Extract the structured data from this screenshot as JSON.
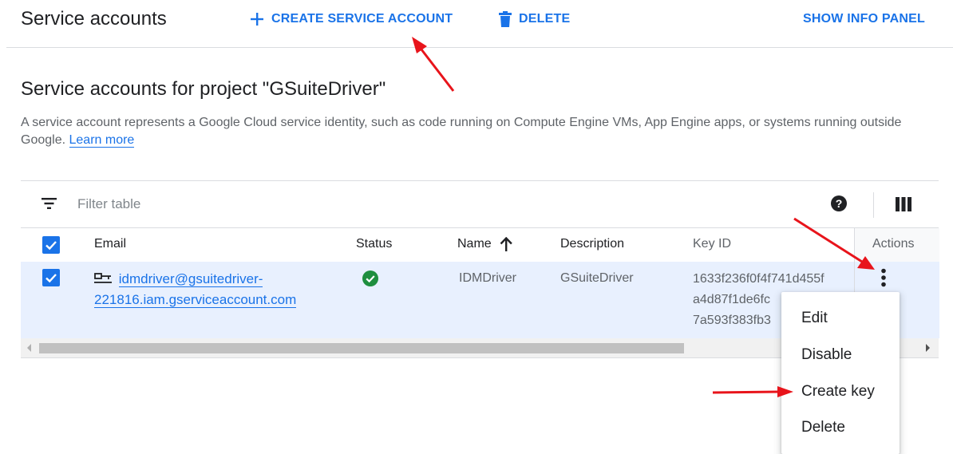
{
  "topbar": {
    "title": "Service accounts",
    "create_label": "CREATE SERVICE ACCOUNT",
    "delete_label": "DELETE",
    "info_label": "SHOW INFO PANEL"
  },
  "section": {
    "title": "Service accounts for project \"GSuiteDriver\"",
    "description": "A service account represents a Google Cloud service identity, such as code running on Compute Engine VMs, App Engine apps, or systems running outside Google.",
    "learn_more": "Learn more"
  },
  "table": {
    "filter_placeholder": "Filter table",
    "columns": {
      "email": "Email",
      "status": "Status",
      "name": "Name",
      "description": "Description",
      "key_id": "Key ID",
      "actions": "Actions"
    },
    "rows": [
      {
        "email_line1": "idmdriver@gsuitedriver-",
        "email_line2": "221816.iam.gserviceaccount.com",
        "status": "enabled",
        "name": "IDMDriver",
        "description": "GSuiteDriver",
        "key_id_line1": "1633f236f0f4f741d455f",
        "key_id_line2": "a4d87f1de6fc",
        "key_id_line3": "7a593f383fb3"
      }
    ]
  },
  "menu": {
    "items": [
      "Edit",
      "Disable",
      "Create key",
      "Delete"
    ]
  },
  "colors": {
    "accent": "#1a73e8",
    "status_ok": "#1e8e3e",
    "row_selected": "#e8f0fe",
    "annotation": "#e8141b"
  }
}
